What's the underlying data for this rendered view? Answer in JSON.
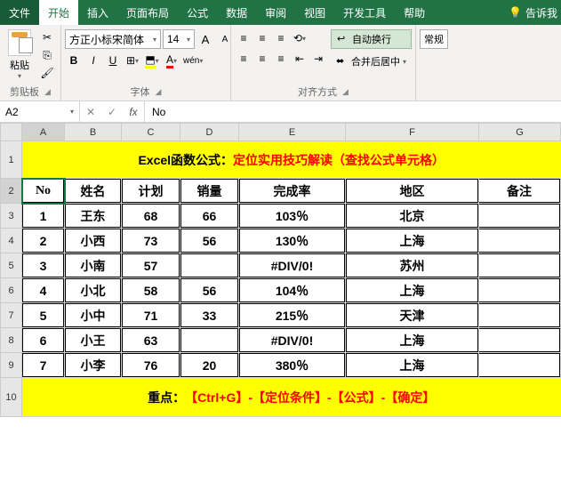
{
  "menu": {
    "file": "文件",
    "home": "开始",
    "insert": "插入",
    "page_layout": "页面布局",
    "formulas": "公式",
    "data": "数据",
    "review": "审阅",
    "view": "视图",
    "dev": "开发工具",
    "help": "帮助",
    "tell_me": "告诉我"
  },
  "ribbon": {
    "clipboard": {
      "label": "剪贴板",
      "paste": "粘贴"
    },
    "font": {
      "label": "字体",
      "name": "方正小标宋简体",
      "size": "14",
      "increase": "A",
      "decrease": "A",
      "bold": "B",
      "italic": "I",
      "underline": "U",
      "wen": "wén"
    },
    "align": {
      "label": "对齐方式",
      "wrap": "自动换行",
      "merge": "合并后居中"
    },
    "number": {
      "label": "常规"
    }
  },
  "namebox": "A2",
  "formula_value": "No",
  "columns": [
    "A",
    "B",
    "C",
    "D",
    "E",
    "F",
    "G"
  ],
  "title": {
    "prefix": "Excel函数公式：",
    "main": "定位实用技巧解读（查找公式单元格）"
  },
  "headers": {
    "no": "No",
    "name": "姓名",
    "plan": "计划",
    "sales": "销量",
    "rate": "完成率",
    "region": "地区",
    "remark": "备注"
  },
  "rows": [
    {
      "no": "1",
      "name": "王东",
      "plan": "68",
      "sales": "66",
      "rate": "103％",
      "region": "北京"
    },
    {
      "no": "2",
      "name": "小西",
      "plan": "73",
      "sales": "56",
      "rate": "130％",
      "region": "上海"
    },
    {
      "no": "3",
      "name": "小南",
      "plan": "57",
      "sales": "",
      "rate": "#DIV/0!",
      "region": "苏州"
    },
    {
      "no": "4",
      "name": "小北",
      "plan": "58",
      "sales": "56",
      "rate": "104％",
      "region": "上海"
    },
    {
      "no": "5",
      "name": "小中",
      "plan": "71",
      "sales": "33",
      "rate": "215％",
      "region": "天津"
    },
    {
      "no": "6",
      "name": "小王",
      "plan": "63",
      "sales": "",
      "rate": "#DIV/0!",
      "region": "上海"
    },
    {
      "no": "7",
      "name": "小李",
      "plan": "76",
      "sales": "20",
      "rate": "380％",
      "region": "上海"
    }
  ],
  "footer": {
    "prefix": "重点：",
    "main": "【Ctrl+G】-【定位条件】-【公式】-【确定】"
  },
  "rownums": [
    "1",
    "2",
    "3",
    "4",
    "5",
    "6",
    "7",
    "8",
    "9",
    "10"
  ]
}
